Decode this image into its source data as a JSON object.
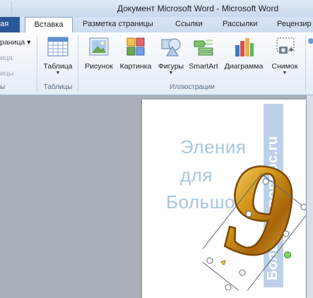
{
  "window": {
    "title": "Документ Microsoft Word  -  Microsoft Word"
  },
  "tabs": [
    {
      "label": "ная"
    },
    {
      "label": "Вставка",
      "active": true
    },
    {
      "label": "Разметка страницы"
    },
    {
      "label": "Ссылки"
    },
    {
      "label": "Рассылки"
    },
    {
      "label": "Рецензир"
    }
  ],
  "ribbon": {
    "pages_group": {
      "item1": "раница ▾",
      "item2": "ица",
      "item3": "ицы",
      "label": "ы"
    },
    "table_group": {
      "table_label": "Таблица",
      "group_label": "Таблицы"
    },
    "illustrations": {
      "picture": "Рисунок",
      "clipart": "Картинка",
      "shapes": "Фигуры",
      "smartart": "SmartArt",
      "chart": "Диаграмма",
      "screenshot": "Снимок",
      "group_label": "Иллюстрации"
    }
  },
  "document": {
    "watermark_lines": [
      "Эления",
      "для",
      "Большой"
    ],
    "vertical_watermark": "Большой-вопрос.ru",
    "wordart_glyph": "9"
  },
  "colors": {
    "file_tab": "#2b579a",
    "watermark": "#a9c5e3",
    "wordart_fill": "#c98a10",
    "wordart_outline": "#7a4a05",
    "rotation_handle": "#7ed957"
  }
}
